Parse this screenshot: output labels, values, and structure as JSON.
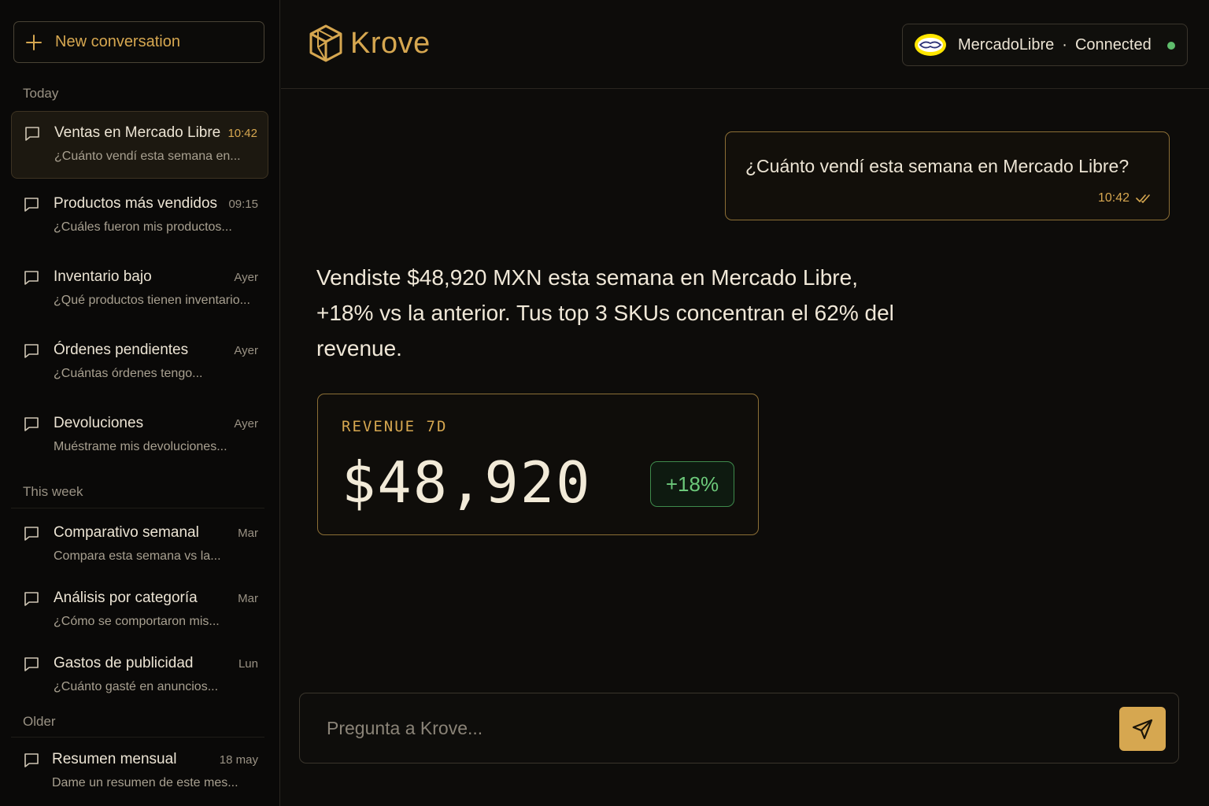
{
  "sidebar": {
    "new_conversation_label": "New conversation",
    "sections": {
      "today": "Today",
      "this_week": "This week",
      "older": "Older"
    },
    "items": [
      {
        "title": "Ventas en Mercado Libre",
        "time": "10:42",
        "preview": "¿Cuánto vendí esta semana en...",
        "active": true
      },
      {
        "title": "Productos más vendidos",
        "time": "09:15",
        "preview": "¿Cuáles fueron mis productos..."
      },
      {
        "title": "Inventario bajo",
        "time": "Ayer",
        "preview": "¿Qué productos tienen inventario..."
      },
      {
        "title": "Órdenes pendientes",
        "time": "Ayer",
        "preview": "¿Cuántas órdenes tengo..."
      },
      {
        "title": "Devoluciones",
        "time": "Ayer",
        "preview": "Muéstrame mis devoluciones..."
      },
      {
        "title": "Comparativo semanal",
        "time": "Mar",
        "preview": "Compara esta semana vs la..."
      },
      {
        "title": "Análisis por categoría",
        "time": "Mar",
        "preview": "¿Cómo se comportaron mis..."
      },
      {
        "title": "Gastos de publicidad",
        "time": "Lun",
        "preview": "¿Cuánto gasté en anuncios..."
      },
      {
        "title": "Resumen mensual",
        "time": "18 may",
        "preview": "Dame un resumen de este mes..."
      }
    ]
  },
  "header": {
    "app_name": "Krove",
    "connection": {
      "service": "MercadoLibre",
      "separator": "·",
      "status": "Connected"
    }
  },
  "chat": {
    "user_message": {
      "text": "¿Cuánto vendí esta semana en Mercado Libre?",
      "time": "10:42"
    },
    "assistant_message": {
      "text": "Vendiste $48,920 MXN esta semana en Mercado Libre, +18% vs la anterior. Tus top 3 SKUs concentran el 62% del revenue."
    },
    "revenue_card": {
      "label": "REVENUE 7D",
      "value": "$48,920",
      "change": "+18%"
    }
  },
  "composer": {
    "placeholder": "Pregunta a Krove..."
  },
  "colors": {
    "accent": "#d6a750",
    "positive": "#6cc87a",
    "background": "#0d0c0a",
    "status_dot": "#5fbd6c"
  }
}
